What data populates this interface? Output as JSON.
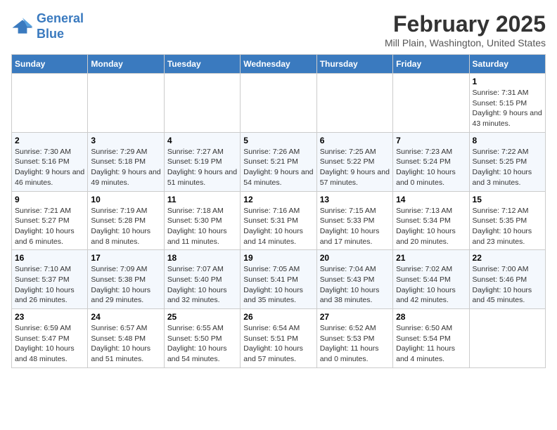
{
  "logo": {
    "line1": "General",
    "line2": "Blue"
  },
  "title": "February 2025",
  "subtitle": "Mill Plain, Washington, United States",
  "days_of_week": [
    "Sunday",
    "Monday",
    "Tuesday",
    "Wednesday",
    "Thursday",
    "Friday",
    "Saturday"
  ],
  "weeks": [
    [
      {
        "day": "",
        "info": ""
      },
      {
        "day": "",
        "info": ""
      },
      {
        "day": "",
        "info": ""
      },
      {
        "day": "",
        "info": ""
      },
      {
        "day": "",
        "info": ""
      },
      {
        "day": "",
        "info": ""
      },
      {
        "day": "1",
        "info": "Sunrise: 7:31 AM\nSunset: 5:15 PM\nDaylight: 9 hours and 43 minutes."
      }
    ],
    [
      {
        "day": "2",
        "info": "Sunrise: 7:30 AM\nSunset: 5:16 PM\nDaylight: 9 hours and 46 minutes."
      },
      {
        "day": "3",
        "info": "Sunrise: 7:29 AM\nSunset: 5:18 PM\nDaylight: 9 hours and 49 minutes."
      },
      {
        "day": "4",
        "info": "Sunrise: 7:27 AM\nSunset: 5:19 PM\nDaylight: 9 hours and 51 minutes."
      },
      {
        "day": "5",
        "info": "Sunrise: 7:26 AM\nSunset: 5:21 PM\nDaylight: 9 hours and 54 minutes."
      },
      {
        "day": "6",
        "info": "Sunrise: 7:25 AM\nSunset: 5:22 PM\nDaylight: 9 hours and 57 minutes."
      },
      {
        "day": "7",
        "info": "Sunrise: 7:23 AM\nSunset: 5:24 PM\nDaylight: 10 hours and 0 minutes."
      },
      {
        "day": "8",
        "info": "Sunrise: 7:22 AM\nSunset: 5:25 PM\nDaylight: 10 hours and 3 minutes."
      }
    ],
    [
      {
        "day": "9",
        "info": "Sunrise: 7:21 AM\nSunset: 5:27 PM\nDaylight: 10 hours and 6 minutes."
      },
      {
        "day": "10",
        "info": "Sunrise: 7:19 AM\nSunset: 5:28 PM\nDaylight: 10 hours and 8 minutes."
      },
      {
        "day": "11",
        "info": "Sunrise: 7:18 AM\nSunset: 5:30 PM\nDaylight: 10 hours and 11 minutes."
      },
      {
        "day": "12",
        "info": "Sunrise: 7:16 AM\nSunset: 5:31 PM\nDaylight: 10 hours and 14 minutes."
      },
      {
        "day": "13",
        "info": "Sunrise: 7:15 AM\nSunset: 5:33 PM\nDaylight: 10 hours and 17 minutes."
      },
      {
        "day": "14",
        "info": "Sunrise: 7:13 AM\nSunset: 5:34 PM\nDaylight: 10 hours and 20 minutes."
      },
      {
        "day": "15",
        "info": "Sunrise: 7:12 AM\nSunset: 5:35 PM\nDaylight: 10 hours and 23 minutes."
      }
    ],
    [
      {
        "day": "16",
        "info": "Sunrise: 7:10 AM\nSunset: 5:37 PM\nDaylight: 10 hours and 26 minutes."
      },
      {
        "day": "17",
        "info": "Sunrise: 7:09 AM\nSunset: 5:38 PM\nDaylight: 10 hours and 29 minutes."
      },
      {
        "day": "18",
        "info": "Sunrise: 7:07 AM\nSunset: 5:40 PM\nDaylight: 10 hours and 32 minutes."
      },
      {
        "day": "19",
        "info": "Sunrise: 7:05 AM\nSunset: 5:41 PM\nDaylight: 10 hours and 35 minutes."
      },
      {
        "day": "20",
        "info": "Sunrise: 7:04 AM\nSunset: 5:43 PM\nDaylight: 10 hours and 38 minutes."
      },
      {
        "day": "21",
        "info": "Sunrise: 7:02 AM\nSunset: 5:44 PM\nDaylight: 10 hours and 42 minutes."
      },
      {
        "day": "22",
        "info": "Sunrise: 7:00 AM\nSunset: 5:46 PM\nDaylight: 10 hours and 45 minutes."
      }
    ],
    [
      {
        "day": "23",
        "info": "Sunrise: 6:59 AM\nSunset: 5:47 PM\nDaylight: 10 hours and 48 minutes."
      },
      {
        "day": "24",
        "info": "Sunrise: 6:57 AM\nSunset: 5:48 PM\nDaylight: 10 hours and 51 minutes."
      },
      {
        "day": "25",
        "info": "Sunrise: 6:55 AM\nSunset: 5:50 PM\nDaylight: 10 hours and 54 minutes."
      },
      {
        "day": "26",
        "info": "Sunrise: 6:54 AM\nSunset: 5:51 PM\nDaylight: 10 hours and 57 minutes."
      },
      {
        "day": "27",
        "info": "Sunrise: 6:52 AM\nSunset: 5:53 PM\nDaylight: 11 hours and 0 minutes."
      },
      {
        "day": "28",
        "info": "Sunrise: 6:50 AM\nSunset: 5:54 PM\nDaylight: 11 hours and 4 minutes."
      },
      {
        "day": "",
        "info": ""
      }
    ]
  ]
}
